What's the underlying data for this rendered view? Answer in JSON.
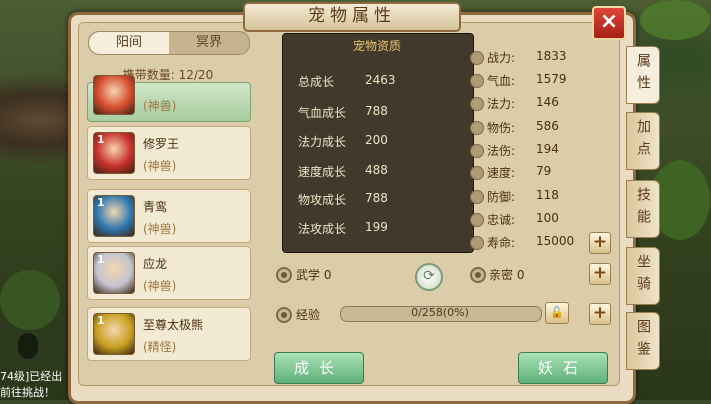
{
  "title": "宠物属性",
  "close_icon": "×",
  "world_tabs": [
    "阳间",
    "冥界"
  ],
  "carry_count": "携带数量: 12/20",
  "pets": [
    {
      "name": "",
      "type": "(神兽)",
      "level": "",
      "selected": true,
      "color": "#d64b2e"
    },
    {
      "name": "修罗王",
      "type": "(神兽)",
      "level": "1",
      "selected": false,
      "color": "#c9302b"
    },
    {
      "name": "青鸾",
      "type": "(神兽)",
      "level": "1",
      "selected": false,
      "color": "#2f77b0"
    },
    {
      "name": "应龙",
      "type": "(神兽)",
      "level": "1",
      "selected": false,
      "color": "#c4c4d0"
    },
    {
      "name": "至尊太极熊",
      "type": "(精怪)",
      "level": "1",
      "selected": false,
      "color": "#c9a020"
    }
  ],
  "quality": {
    "title": "宠物资质",
    "rows": [
      {
        "label": "总成长",
        "value": "2463"
      },
      {
        "label": "气血成长",
        "value": "788"
      },
      {
        "label": "法力成长",
        "value": "200"
      },
      {
        "label": "速度成长",
        "value": "488"
      },
      {
        "label": "物攻成长",
        "value": "788"
      },
      {
        "label": "法攻成长",
        "value": "199"
      }
    ]
  },
  "stats": [
    {
      "label": "战力:",
      "value": "1833"
    },
    {
      "label": "气血:",
      "value": "1579"
    },
    {
      "label": "法力:",
      "value": "146"
    },
    {
      "label": "物伤:",
      "value": "586"
    },
    {
      "label": "法伤:",
      "value": "194"
    },
    {
      "label": "速度:",
      "value": "79"
    },
    {
      "label": "防御:",
      "value": "118"
    },
    {
      "label": "忠诚:",
      "value": "100"
    },
    {
      "label": "寿命:",
      "value": "15000"
    }
  ],
  "martial": "武学 0",
  "intimacy": "亲密 0",
  "exp_label": "经验",
  "exp_text": "0/258(0%)",
  "exp_fraction": 0,
  "buttons": {
    "grow": "成长",
    "stone": "妖石"
  },
  "side_tabs": [
    "属性",
    "加点",
    "技能",
    "坐骑",
    "图鉴"
  ],
  "chat": [
    "74级]已经出",
    "前往挑战！"
  ]
}
